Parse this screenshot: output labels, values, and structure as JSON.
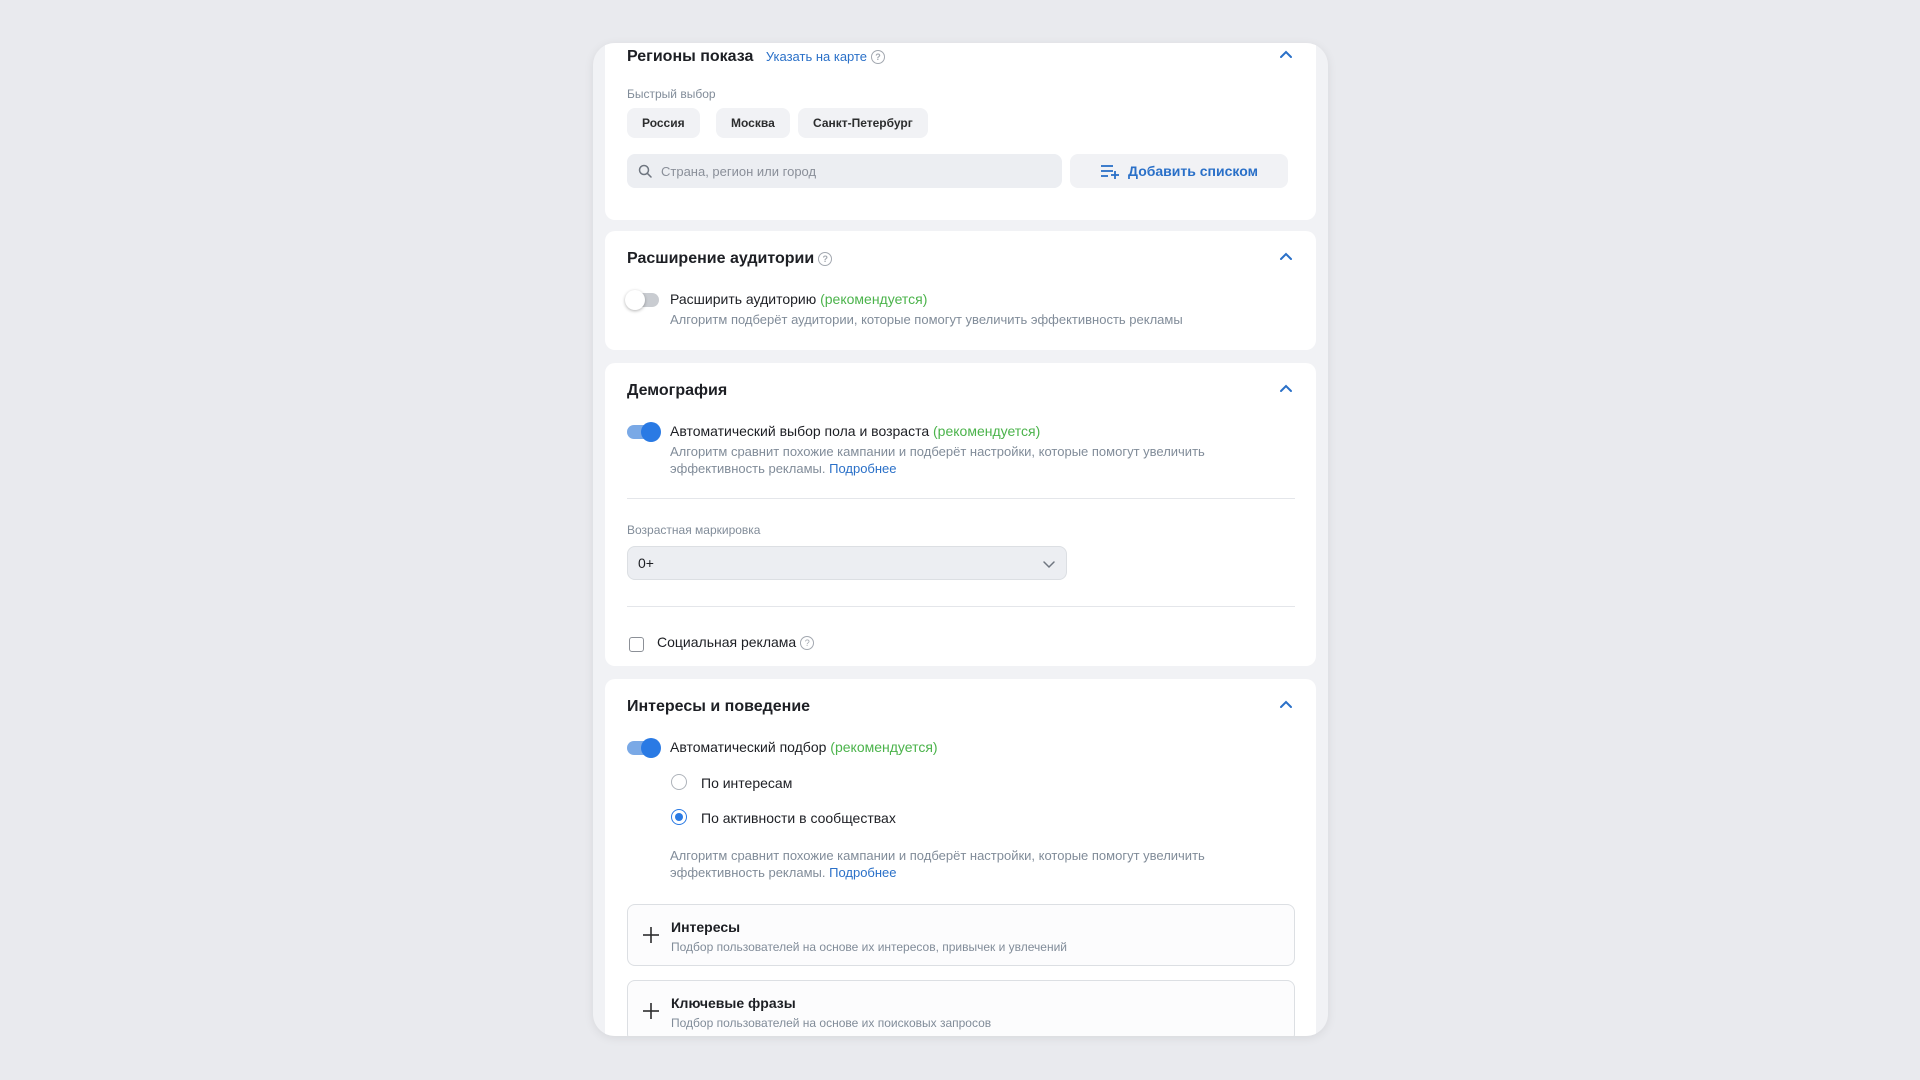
{
  "regions": {
    "title": "Регионы показа",
    "map_link": "Указать на карте",
    "quick_label": "Быстрый выбор",
    "chips": [
      "Россия",
      "Москва",
      "Санкт-Петербург"
    ],
    "search_placeholder": "Страна, регион или город",
    "add_list": "Добавить списком"
  },
  "audience": {
    "title": "Расширение аудитории",
    "toggle_label": "Расширить аудиторию",
    "recommended": "(рекомендуется)",
    "description": "Алгоритм подберёт аудитории, которые помогут увеличить эффективность рекламы"
  },
  "demography": {
    "title": "Демография",
    "toggle_label": "Автоматический выбор пола и возраста",
    "recommended": "(рекомендуется)",
    "description": "Алгоритм сравнит похожие кампании и подберёт настройки, которые помогут увеличить эффективность рекламы.",
    "more": "Подробнее",
    "age_label": "Возрастная маркировка",
    "age_value": "0+",
    "social_label": "Социальная реклама"
  },
  "interests": {
    "title": "Интересы и поведение",
    "toggle_label": "Автоматический подбор",
    "recommended": "(рекомендуется)",
    "radio_options": [
      "По интересам",
      "По активности в сообществах"
    ],
    "selected_option": "По активности в сообществах",
    "description": "Алгоритм сравнит похожие кампании и подберёт настройки, которые помогут увеличить эффективность рекламы.",
    "more": "Подробнее",
    "sections": [
      {
        "title": "Интересы",
        "description": "Подбор пользователей на основе их интересов, привычек и увлечений"
      },
      {
        "title": "Ключевые фразы",
        "description": "Подбор пользователей на основе их поисковых запросов"
      }
    ]
  },
  "icons": {
    "help": "help-icon",
    "chevron": "chevron-up-icon",
    "search": "search-icon",
    "add_list": "list-add-icon",
    "dropdown": "chevron-down-icon",
    "plus": "plus-icon"
  },
  "colors": {
    "accent": "#2a7ae4",
    "link": "#2a70c8",
    "recommended": "#4bb34b",
    "background": "#e9eaee"
  }
}
